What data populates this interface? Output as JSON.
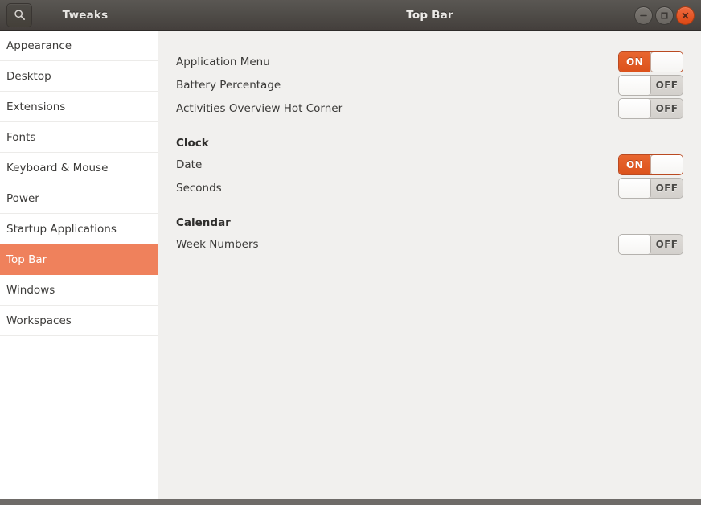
{
  "titlebar": {
    "app_title": "Tweaks",
    "window_title": "Top Bar",
    "search_icon": "search-icon",
    "controls": {
      "minimize": "minimize-icon",
      "maximize": "maximize-icon",
      "close": "close-icon"
    }
  },
  "sidebar": {
    "items": [
      {
        "label": "Appearance",
        "selected": false
      },
      {
        "label": "Desktop",
        "selected": false
      },
      {
        "label": "Extensions",
        "selected": false
      },
      {
        "label": "Fonts",
        "selected": false
      },
      {
        "label": "Keyboard & Mouse",
        "selected": false
      },
      {
        "label": "Power",
        "selected": false
      },
      {
        "label": "Startup Applications",
        "selected": false
      },
      {
        "label": "Top Bar",
        "selected": true
      },
      {
        "label": "Windows",
        "selected": false
      },
      {
        "label": "Workspaces",
        "selected": false
      }
    ]
  },
  "content": {
    "rows": [
      {
        "label": "Application Menu",
        "state": "ON"
      },
      {
        "label": "Battery Percentage",
        "state": "OFF"
      },
      {
        "label": "Activities Overview Hot Corner",
        "state": "OFF"
      }
    ],
    "sections": [
      {
        "heading": "Clock",
        "rows": [
          {
            "label": "Date",
            "state": "ON"
          },
          {
            "label": "Seconds",
            "state": "OFF"
          }
        ]
      },
      {
        "heading": "Calendar",
        "rows": [
          {
            "label": "Week Numbers",
            "state": "OFF"
          }
        ]
      }
    ]
  },
  "colors": {
    "accent_selection": "#ef815c",
    "switch_on": "#dc521b",
    "titlebar": "#504d49",
    "content_bg": "#f1f0ee",
    "close_button": "#dd4814"
  }
}
